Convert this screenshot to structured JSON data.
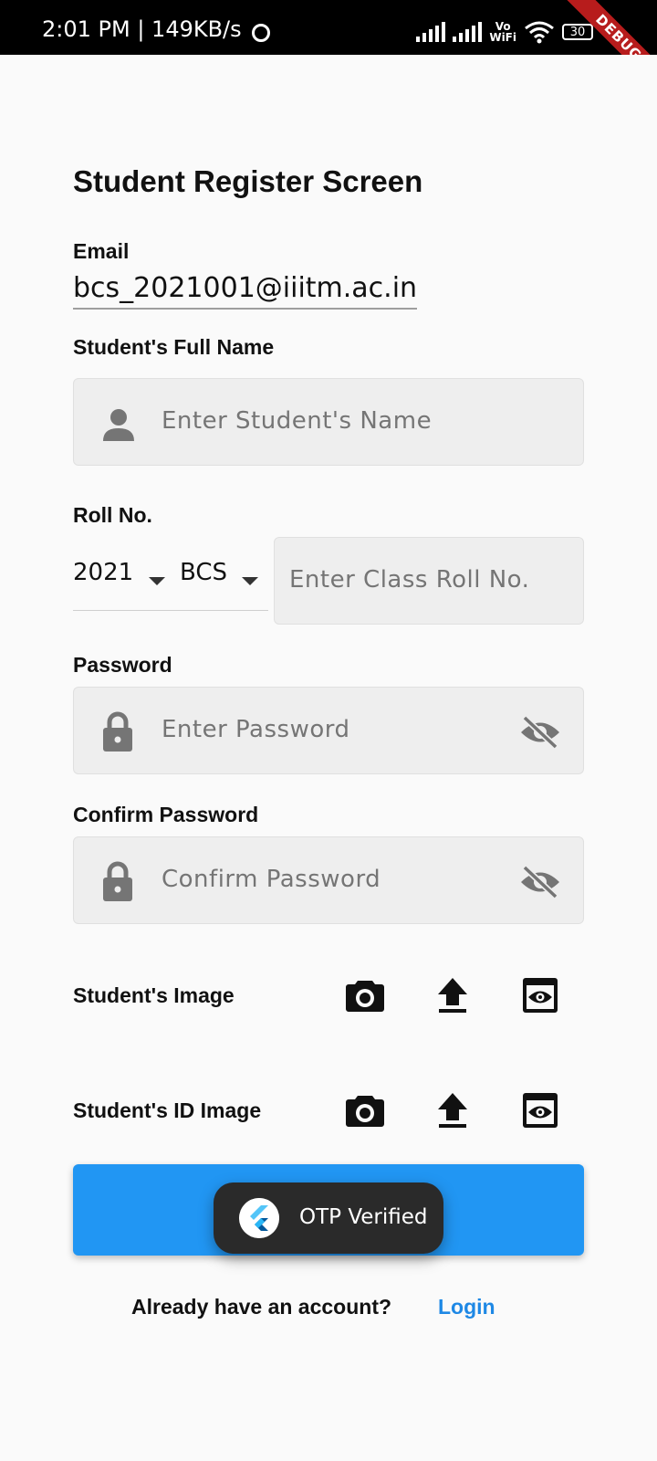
{
  "status_bar": {
    "time": "2:01 PM | 149KB/s",
    "vowifi_top": "Vo",
    "vowifi_bottom": "WiFi",
    "battery": "30",
    "debug_banner": "DEBUG"
  },
  "screen": {
    "title": "Student Register Screen"
  },
  "email": {
    "label": "Email",
    "value": "bcs_2021001@iiitm.ac.in"
  },
  "full_name": {
    "label": "Student's Full Name",
    "placeholder": "Enter Student's Name",
    "icon": "person-icon"
  },
  "roll": {
    "label": "Roll No.",
    "year_selected": "2021",
    "branch_selected": "BCS",
    "placeholder": "Enter Class Roll No."
  },
  "password": {
    "label": "Password",
    "placeholder": "Enter Password",
    "icon": "lock-icon",
    "toggle_icon": "visibility-off-icon"
  },
  "confirm_password": {
    "label": "Confirm Password",
    "placeholder": "Confirm Password",
    "icon": "lock-icon",
    "toggle_icon": "visibility-off-icon"
  },
  "student_image": {
    "label": "Student's Image",
    "actions": [
      "camera-icon",
      "upload-icon",
      "preview-icon"
    ]
  },
  "id_image": {
    "label": "Student's ID Image",
    "actions": [
      "camera-icon",
      "upload-icon",
      "preview-icon"
    ]
  },
  "register_button": {
    "color": "#2196f3"
  },
  "toast": {
    "text": "OTP Verified"
  },
  "footer": {
    "question": "Already have an account?",
    "login_link": "Login",
    "link_color": "#1e88e5"
  }
}
